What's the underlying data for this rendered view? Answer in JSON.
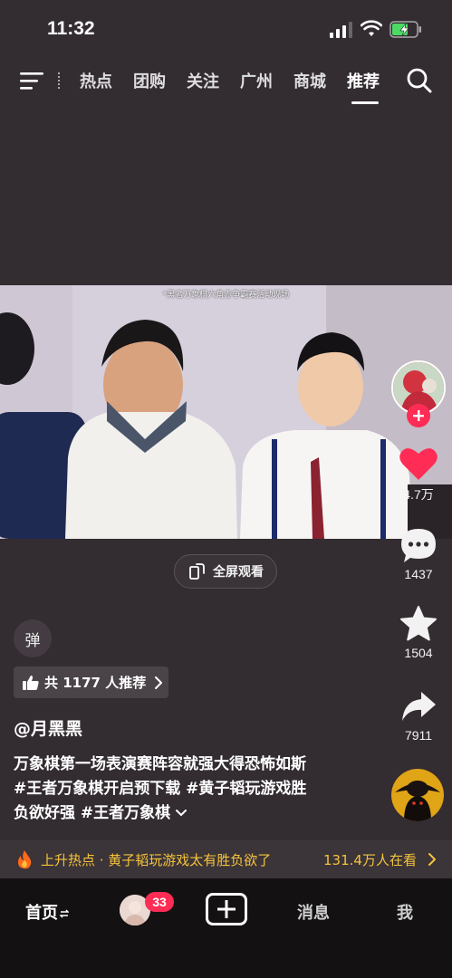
{
  "status": {
    "time": "11:32"
  },
  "topnav": {
    "tabs": [
      "热点",
      "团购",
      "关注",
      "广州",
      "商城",
      "推荐"
    ],
    "active_tab": "推荐"
  },
  "video": {
    "subtitle": "*黑者万象棋六角赤争霸赛活动现场"
  },
  "fullscreen_label": "全屏观看",
  "danmu_label": "弹",
  "recommend": {
    "text": "共 1177 人推荐"
  },
  "author": "@月黑黑",
  "caption": {
    "line1": "万象棋第一场表演赛阵容就强大得恐怖如斯",
    "line2": "#王者万象棋开启预下载 #黄子韬玩游戏胜",
    "line3": "负欲好强 #王者万象棋"
  },
  "rail": {
    "likes": "4.7万",
    "comments": "1437",
    "favorites": "1504",
    "shares": "7911"
  },
  "hot": {
    "text": "上升热点 · 黄子韬玩游戏太有胜负欲了",
    "count": "131.4万人在看"
  },
  "bottom_nav": {
    "home": "首页",
    "friends_badge": "33",
    "messages": "消息",
    "me": "我"
  },
  "colors": {
    "accent": "#ff2c55",
    "hot": "#f5c33b",
    "background": "#332c31"
  }
}
